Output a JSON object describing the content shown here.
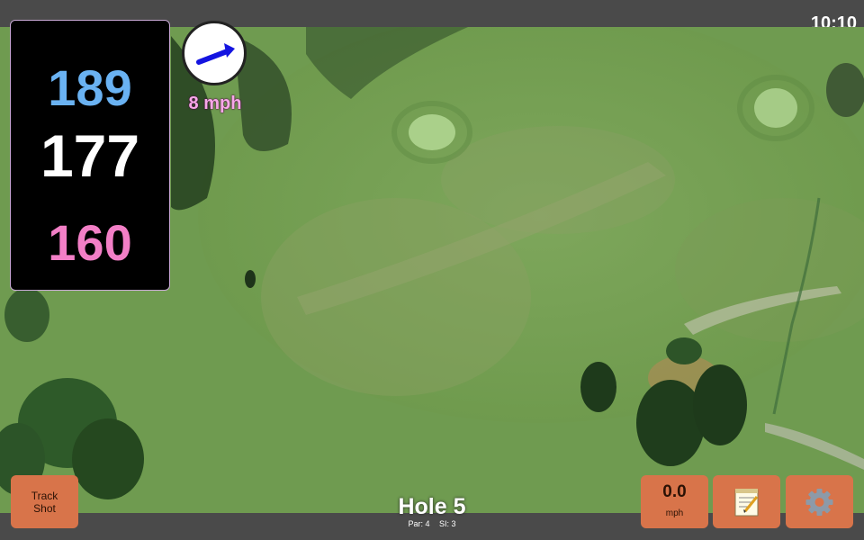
{
  "status": {
    "time": "10:10"
  },
  "yardages": {
    "back": "189",
    "middle": "177",
    "front": "160"
  },
  "wind": {
    "speed_label": "8 mph"
  },
  "buttons": {
    "track_line1": "Track",
    "track_line2": "Shot",
    "speed_value": "0.0",
    "speed_unit": "mph"
  },
  "hole": {
    "title": "Hole 5",
    "par_label": "Par: 4",
    "si_label": "SI: 3"
  },
  "icons": {
    "notes": "notepad-icon",
    "settings": "gear-icon",
    "wind": "wind-arrow-icon"
  },
  "colors": {
    "back_yardage": "#6ab2f2",
    "middle_yardage": "#ffffff",
    "front_yardage": "#f27fc6",
    "button": "#d8744a",
    "wind_label": "#f7a8e8"
  }
}
